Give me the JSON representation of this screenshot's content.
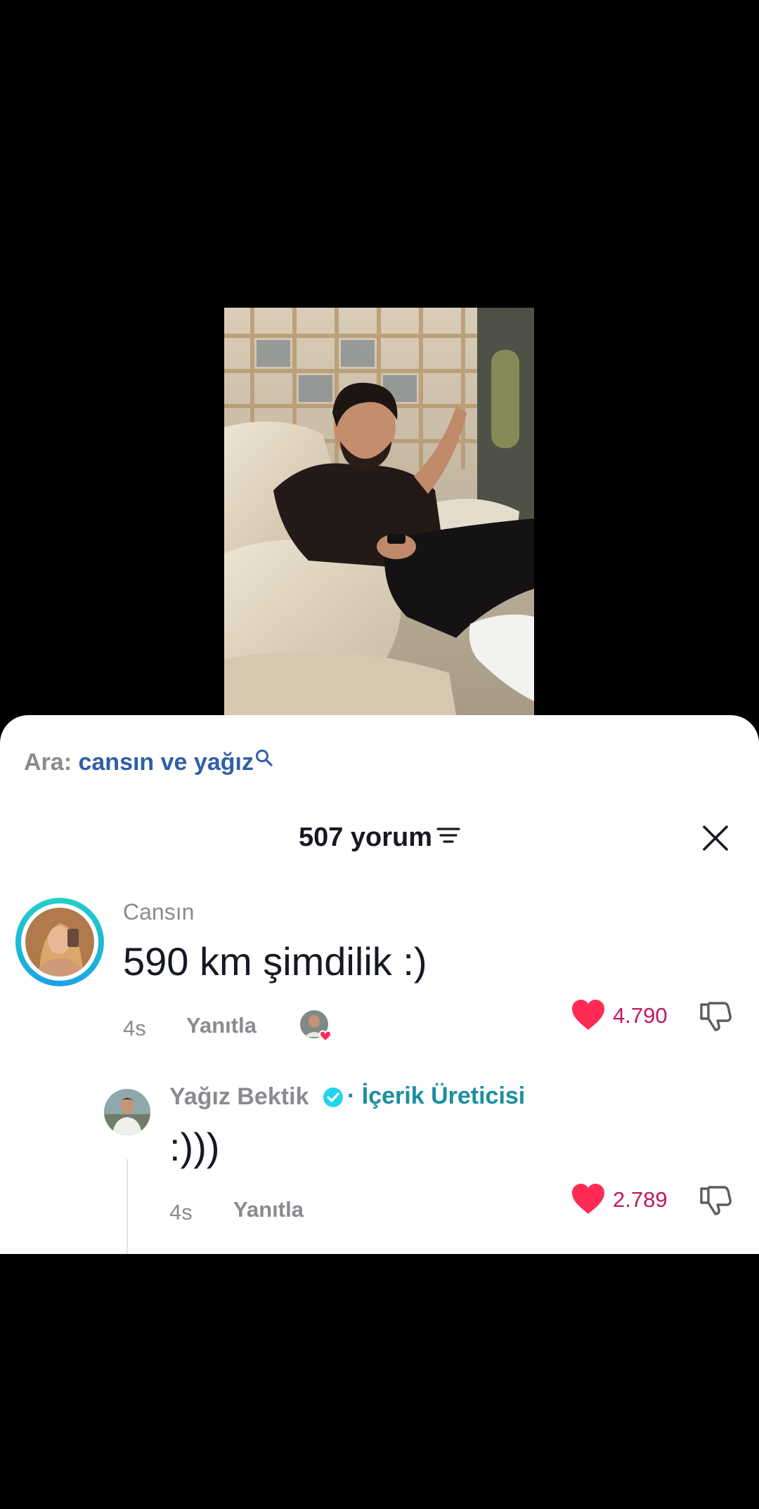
{
  "search": {
    "label": "Ara:",
    "query": "cansın ve yağız"
  },
  "header": {
    "count_label": "507 yorum"
  },
  "comments": [
    {
      "username": "Cansın",
      "text": "590 km şimdilik :)",
      "time": "4s",
      "reply_label": "Yanıtla",
      "likes": "4.790"
    }
  ],
  "replies": [
    {
      "username": "Yağız Bektik",
      "badge": "· İçerik Üreticisi",
      "text": ":)))",
      "time": "4s",
      "reply_label": "Yanıtla",
      "likes": "2.789"
    }
  ],
  "icons": {
    "search": "magnifier-icon",
    "filter": "filter-icon",
    "close": "close-icon",
    "like": "heart-icon",
    "dislike": "thumbs-down-icon",
    "verified": "verified-badge-icon"
  },
  "colors": {
    "background": "#000000",
    "sheet": "#ffffff",
    "search_query": "#2f5fa7",
    "heart": "#fe2c55",
    "like_count": "#c2185b",
    "badge": "#1b8fa0",
    "avatar_ring": "#22d3c5"
  }
}
